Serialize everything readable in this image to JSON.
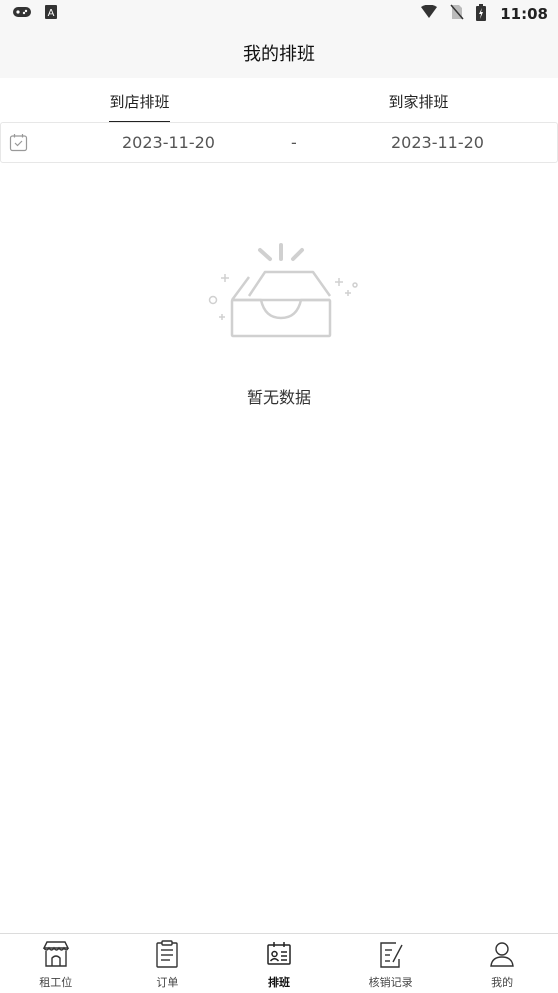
{
  "status_bar": {
    "time": "11:08",
    "icons_left": [
      "gamepad-icon",
      "a-letter-icon"
    ],
    "icons_right": [
      "wifi-icon",
      "no-sim-icon",
      "battery-charging-icon"
    ]
  },
  "header": {
    "title": "我的排班"
  },
  "tabs": [
    {
      "label": "到店排班",
      "active": true
    },
    {
      "label": "到家排班",
      "active": false
    }
  ],
  "date_range": {
    "start": "2023-11-20",
    "separator": "-",
    "end": "2023-11-20",
    "icon": "calendar-icon"
  },
  "empty_state": {
    "text": "暂无数据",
    "icon": "empty-box-icon"
  },
  "bottom_nav": [
    {
      "label": "租工位",
      "icon": "store-icon",
      "active": false
    },
    {
      "label": "订单",
      "icon": "clipboard-icon",
      "active": false
    },
    {
      "label": "排班",
      "icon": "schedule-icon",
      "active": true
    },
    {
      "label": "核销记录",
      "icon": "record-icon",
      "active": false
    },
    {
      "label": "我的",
      "icon": "user-icon",
      "active": false
    }
  ],
  "colors": {
    "accent": "#222222",
    "border": "#e7e7e7",
    "background": "#ffffff",
    "header_bg": "#f7f7f7"
  }
}
